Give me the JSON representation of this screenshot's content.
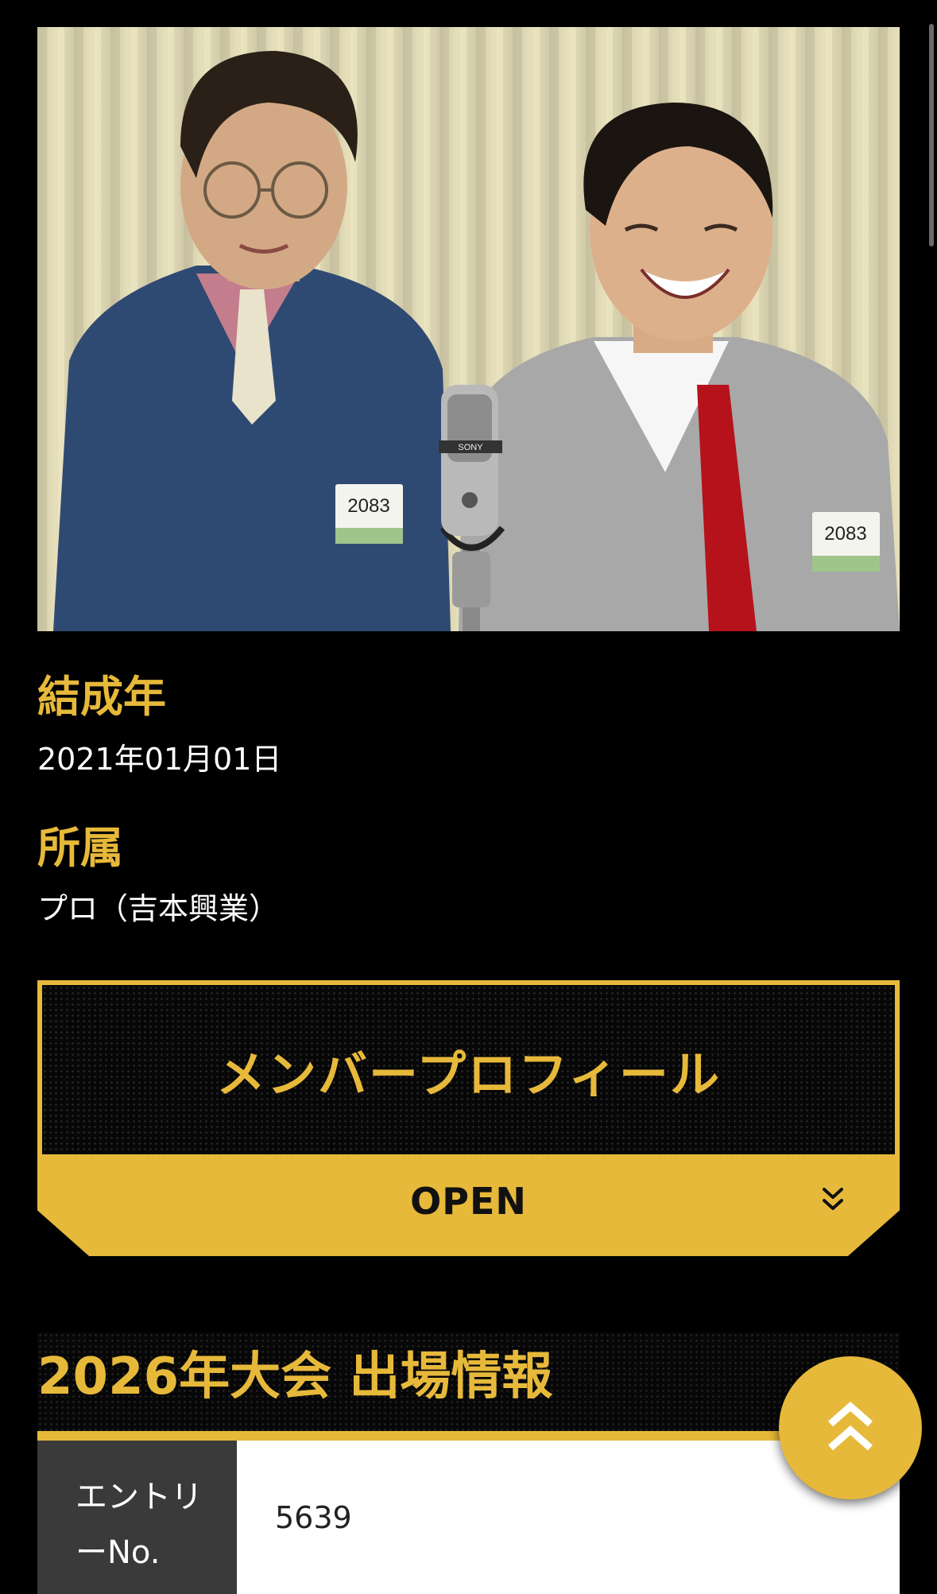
{
  "group": {
    "photo_alt": "",
    "entry_badge_left": "2083",
    "entry_badge_right": "2083",
    "mic_brand": "SONY"
  },
  "fields": {
    "formed_label": "結成年",
    "formed_value": "2021年01月01日",
    "agency_label": "所属",
    "agency_value": "プロ（吉本興業）"
  },
  "profile_toggle": {
    "title": "メンバープロフィール",
    "button_label": "OPEN",
    "icon": "double-chevron-down-icon"
  },
  "entry_section": {
    "title": "2026年大会 出場情報",
    "rows": [
      {
        "key_line1": "エントリ",
        "key_line2": "ーNo.",
        "value": "5639"
      }
    ]
  },
  "back_to_top": {
    "icon": "double-chevron-up-icon"
  },
  "colors": {
    "accent": "#e7b93a",
    "background": "#000000"
  }
}
